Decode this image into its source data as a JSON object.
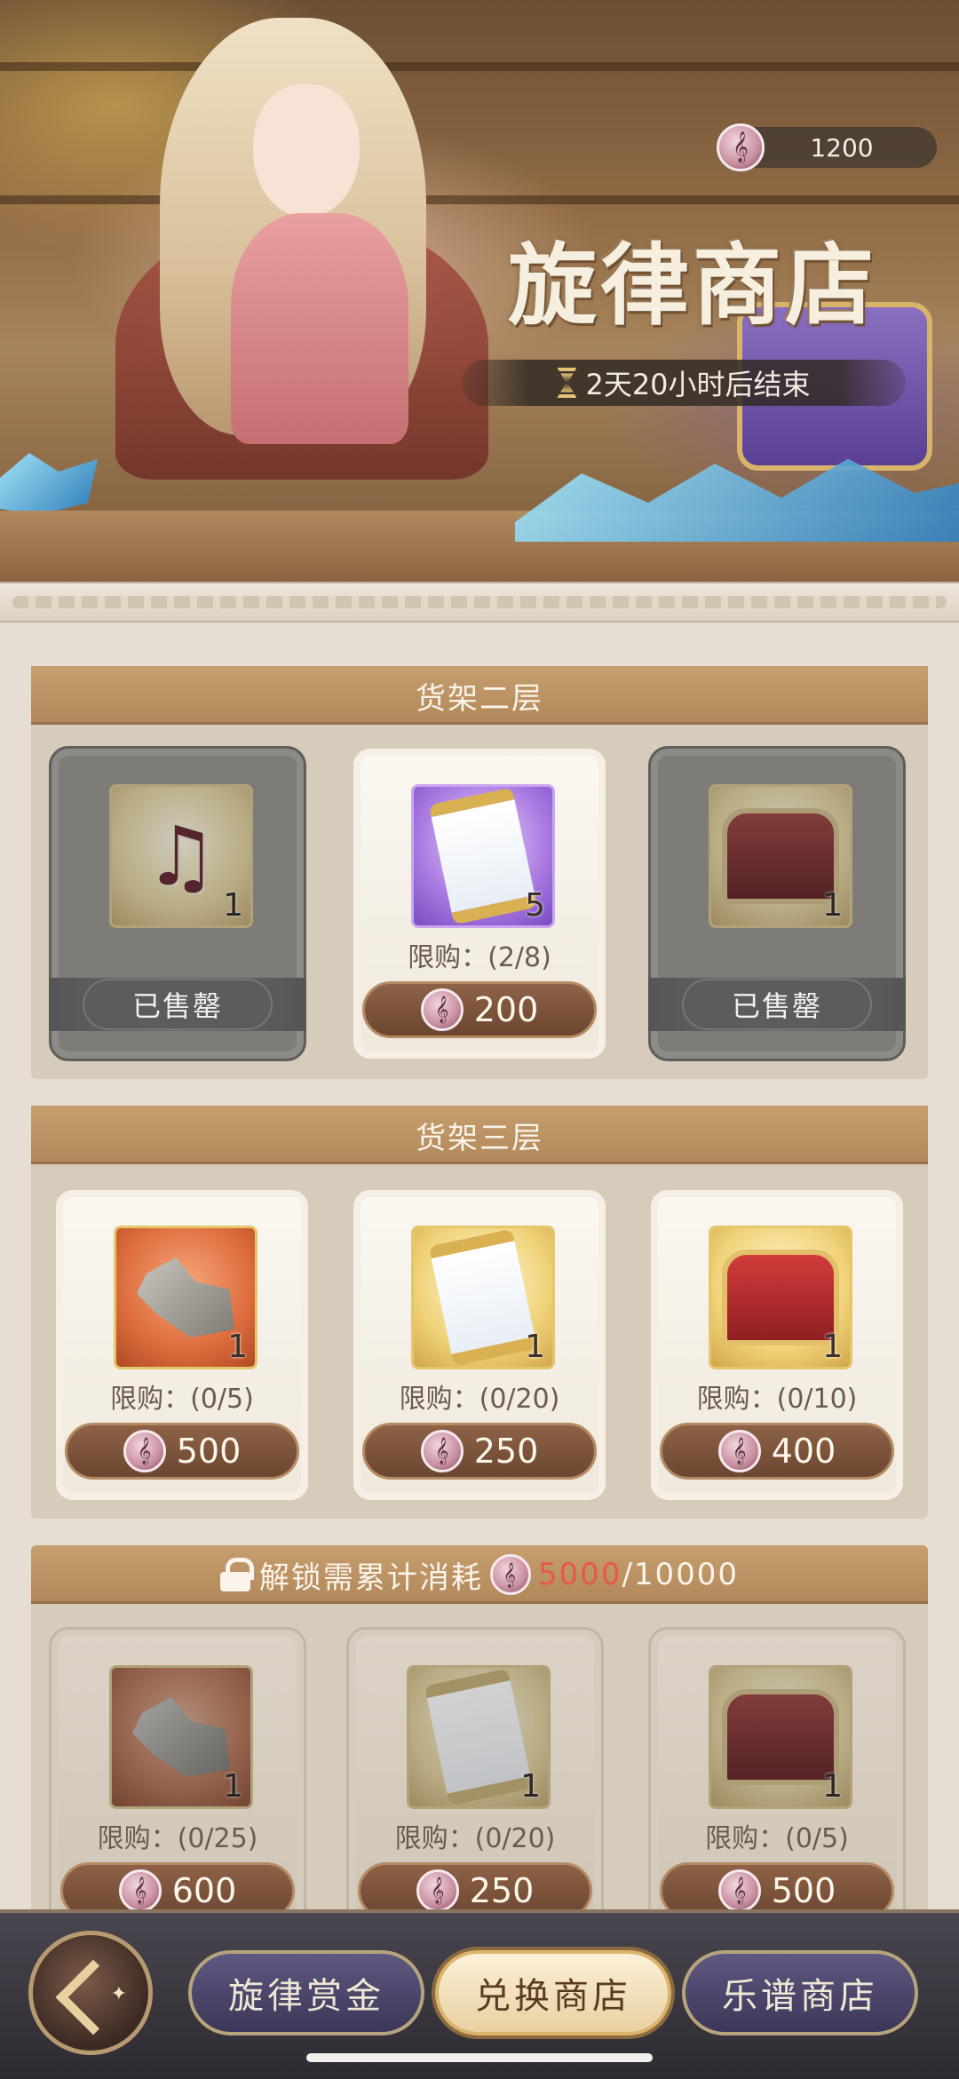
{
  "header": {
    "currency_amount": "1200",
    "currency_icon": "music-note-coin",
    "shop_title": "旋律商店",
    "timer_text": "2天20小时后结束"
  },
  "sections": [
    {
      "title": "货架二层",
      "items": [
        {
          "icon": "music-sheet",
          "qty": "1",
          "state": "sold_out",
          "status_label": "已售罄"
        },
        {
          "icon": "purple-scroll",
          "qty": "5",
          "state": "available",
          "limit": "限购：(2/8)",
          "price": "200"
        },
        {
          "icon": "red-chest",
          "qty": "1",
          "state": "sold_out",
          "status_label": "已售罄"
        }
      ]
    },
    {
      "title": "货架三层",
      "items": [
        {
          "icon": "stone-fragments",
          "qty": "1",
          "state": "available",
          "limit": "限购：(0/5)",
          "price": "500"
        },
        {
          "icon": "gold-scroll",
          "qty": "1",
          "state": "available",
          "limit": "限购：(0/20)",
          "price": "250"
        },
        {
          "icon": "red-chest",
          "qty": "1",
          "state": "available",
          "limit": "限购：(0/10)",
          "price": "400"
        }
      ]
    },
    {
      "title_prefix": "解锁需累计消耗",
      "progress_current": "5000",
      "progress_total": "/10000",
      "locked": true,
      "items": [
        {
          "icon": "stone-fragments",
          "qty": "1",
          "state": "locked",
          "limit": "限购：(0/25)",
          "price": "600"
        },
        {
          "icon": "gold-scroll",
          "qty": "1",
          "state": "locked",
          "limit": "限购：(0/20)",
          "price": "250"
        },
        {
          "icon": "red-chest",
          "qty": "1",
          "state": "locked",
          "limit": "限购：(0/5)",
          "price": "500"
        }
      ]
    }
  ],
  "nav": {
    "tabs": [
      {
        "label": "旋律赏金",
        "active": false
      },
      {
        "label": "兑换商店",
        "active": true
      },
      {
        "label": "乐谱商店",
        "active": false
      }
    ]
  },
  "colors": {
    "accent_red": "#e8574a",
    "header_brown": "#b0875a",
    "price_button": "#6c4631"
  }
}
